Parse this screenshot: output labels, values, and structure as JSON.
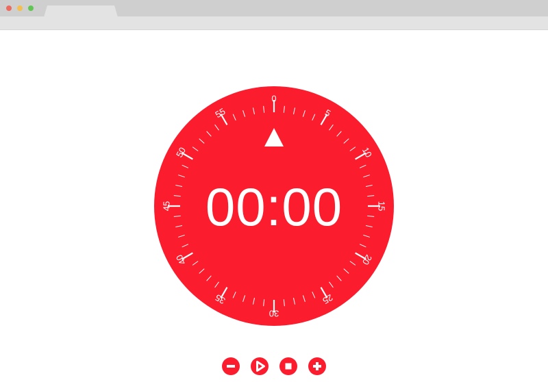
{
  "browser": {
    "controls": [
      "close",
      "minimize",
      "maximize"
    ]
  },
  "timer": {
    "display": "00:00",
    "dial_color": "#fb1c2e",
    "dial_labels": [
      "0",
      "5",
      "10",
      "15",
      "20",
      "25",
      "30",
      "35",
      "40",
      "45",
      "50",
      "55"
    ],
    "pointer_icon": "triangle-up-icon"
  },
  "controls": [
    {
      "name": "decrease-button",
      "icon": "minus-icon"
    },
    {
      "name": "play-button",
      "icon": "play-icon"
    },
    {
      "name": "stop-button",
      "icon": "stop-icon"
    },
    {
      "name": "increase-button",
      "icon": "plus-icon"
    }
  ]
}
